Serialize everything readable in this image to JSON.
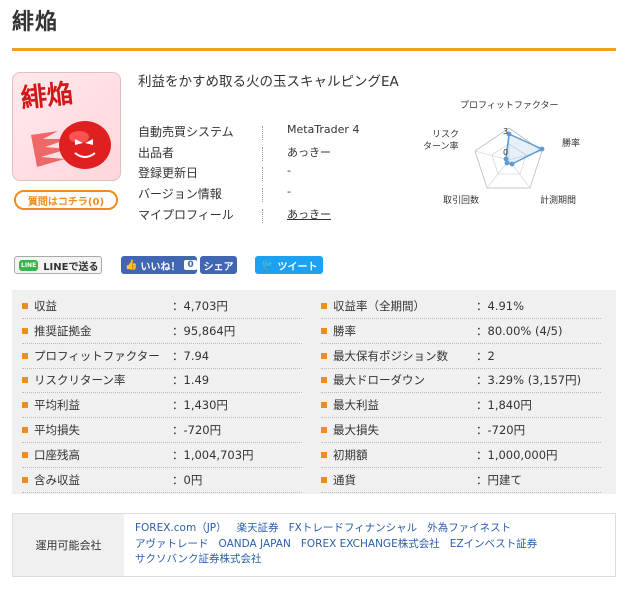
{
  "page_title": "緋焔",
  "thumbnail_text": "緋焔",
  "question_button": "質問はコチラ(0)",
  "ea_title": "利益をかすめ取る火の玉スキャルピングEA",
  "info": [
    {
      "label": "自動売買システム",
      "value": "MetaTrader 4"
    },
    {
      "label": "出品者",
      "value": "あっきー"
    },
    {
      "label": "登録更新日",
      "value": "-"
    },
    {
      "label": "バージョン情報",
      "value": "-"
    },
    {
      "label": "マイプロフィール",
      "value": "あっきー"
    }
  ],
  "radar": {
    "axes": [
      "プロフィットファクター",
      "勝率",
      "計測期間",
      "取引回数",
      "リスクリターン率"
    ],
    "rlabel": "リスク",
    "rlabel2": "ターン率",
    "ticks": [
      "3",
      "0"
    ],
    "color": "#5b9bd5"
  },
  "share": {
    "line": "LINEで送る",
    "line_icon": "LINE",
    "fb_like": "いいね！",
    "fb_count": "0",
    "fb_share": "シェア",
    "tweet": "ツイート"
  },
  "stats": [
    {
      "label": "収益",
      "value": "：4,703円"
    },
    {
      "label": "収益率（全期間）",
      "value": "：4.91%"
    },
    {
      "label": "推奨証拠金",
      "value": "：95,864円"
    },
    {
      "label": "勝率",
      "value": "：80.00% (4/5)"
    },
    {
      "label": "プロフィットファクター",
      "value": "：7.94"
    },
    {
      "label": "最大保有ポジション数",
      "value": "：2"
    },
    {
      "label": "リスクリターン率",
      "value": "：1.49"
    },
    {
      "label": "最大ドローダウン",
      "value": "：3.29% (3,157円)"
    },
    {
      "label": "平均利益",
      "value": "：1,430円"
    },
    {
      "label": "最大利益",
      "value": "：1,840円"
    },
    {
      "label": "平均損失",
      "value": "：-720円"
    },
    {
      "label": "最大損失",
      "value": "：-720円"
    },
    {
      "label": "口座残高",
      "value": "：1,004,703円"
    },
    {
      "label": "初期額",
      "value": "：1,000,000円"
    },
    {
      "label": "含み収益",
      "value": "：0円"
    },
    {
      "label": "通貨",
      "value": "：円建て"
    }
  ],
  "companies": {
    "header": "運用可能会社",
    "lines": [
      [
        "FOREX.com（JP）",
        "楽天証券",
        "FXトレードフィナンシャル",
        "外為ファイネスト"
      ],
      [
        "アヴァトレード",
        "OANDA JAPAN",
        "FOREX EXCHANGE株式会社",
        "EZインベスト証券"
      ],
      [
        "サクソバンク証券株式会社"
      ]
    ]
  }
}
